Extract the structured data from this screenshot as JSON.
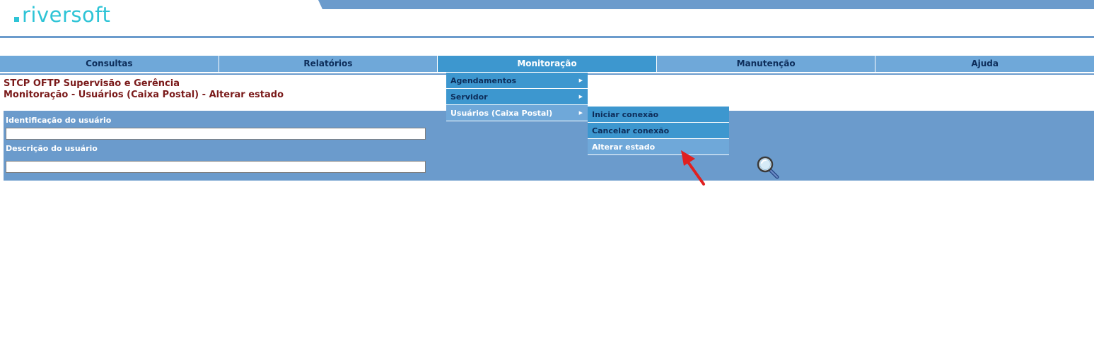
{
  "brand": {
    "logo_text": "riversoft"
  },
  "nav": {
    "items": [
      {
        "label": "Consultas"
      },
      {
        "label": "Relatórios"
      },
      {
        "label": "Monitoração"
      },
      {
        "label": "Manutenção"
      },
      {
        "label": "Ajuda"
      }
    ]
  },
  "menu": {
    "level1": [
      {
        "label": "Agendamentos"
      },
      {
        "label": "Servidor"
      },
      {
        "label": "Usuários (Caixa Postal)"
      }
    ],
    "level2": [
      {
        "label": "Iniciar conexão"
      },
      {
        "label": "Cancelar conexão"
      },
      {
        "label": "Alterar estado"
      }
    ]
  },
  "page": {
    "title": "STCP OFTP Supervisão e Gerência",
    "subtitle": "Monitoração - Usuários (Caixa Postal) - Alterar estado"
  },
  "form": {
    "user_id_label": "Identificação do usuário",
    "user_id_value": "",
    "user_desc_label": "Descrição do usuário",
    "user_desc_value": ""
  },
  "colors": {
    "brand": "#2ec4d6",
    "panel": "#6b9bcc",
    "nav": "#6fa8d9",
    "nav_active": "#3d97cf",
    "title": "#7a1a1a",
    "annotation_arrow": "#e02020"
  },
  "icons": {
    "search": "magnifier-icon",
    "annotation": "red-arrow-annotation"
  }
}
